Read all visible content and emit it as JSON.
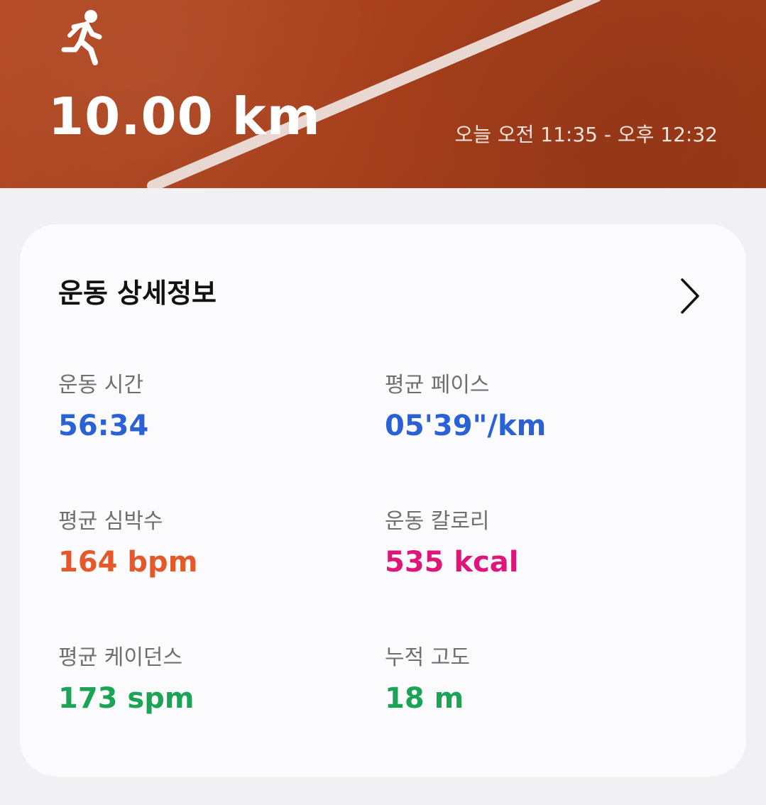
{
  "hero": {
    "activity_icon": "running-person-icon",
    "distance": "10.00 km",
    "time_range": "오늘 오전 11:35 - 오후 12:32"
  },
  "details": {
    "title": "운동 상세정보",
    "chevron_icon": "chevron-right-icon",
    "stats": [
      {
        "label": "운동 시간",
        "value": "56:34",
        "color": "#2a62d6"
      },
      {
        "label": "평균 페이스",
        "value": "05'39\"/km",
        "color": "#2a62d6"
      },
      {
        "label": "평균 심박수",
        "value": "164 bpm",
        "color": "#e5582a"
      },
      {
        "label": "운동 칼로리",
        "value": "535 kcal",
        "color": "#e0157a"
      },
      {
        "label": "평균 케이던스",
        "value": "173 spm",
        "color": "#1ba456"
      },
      {
        "label": "누적 고도",
        "value": "18 m",
        "color": "#1ba456"
      }
    ]
  }
}
